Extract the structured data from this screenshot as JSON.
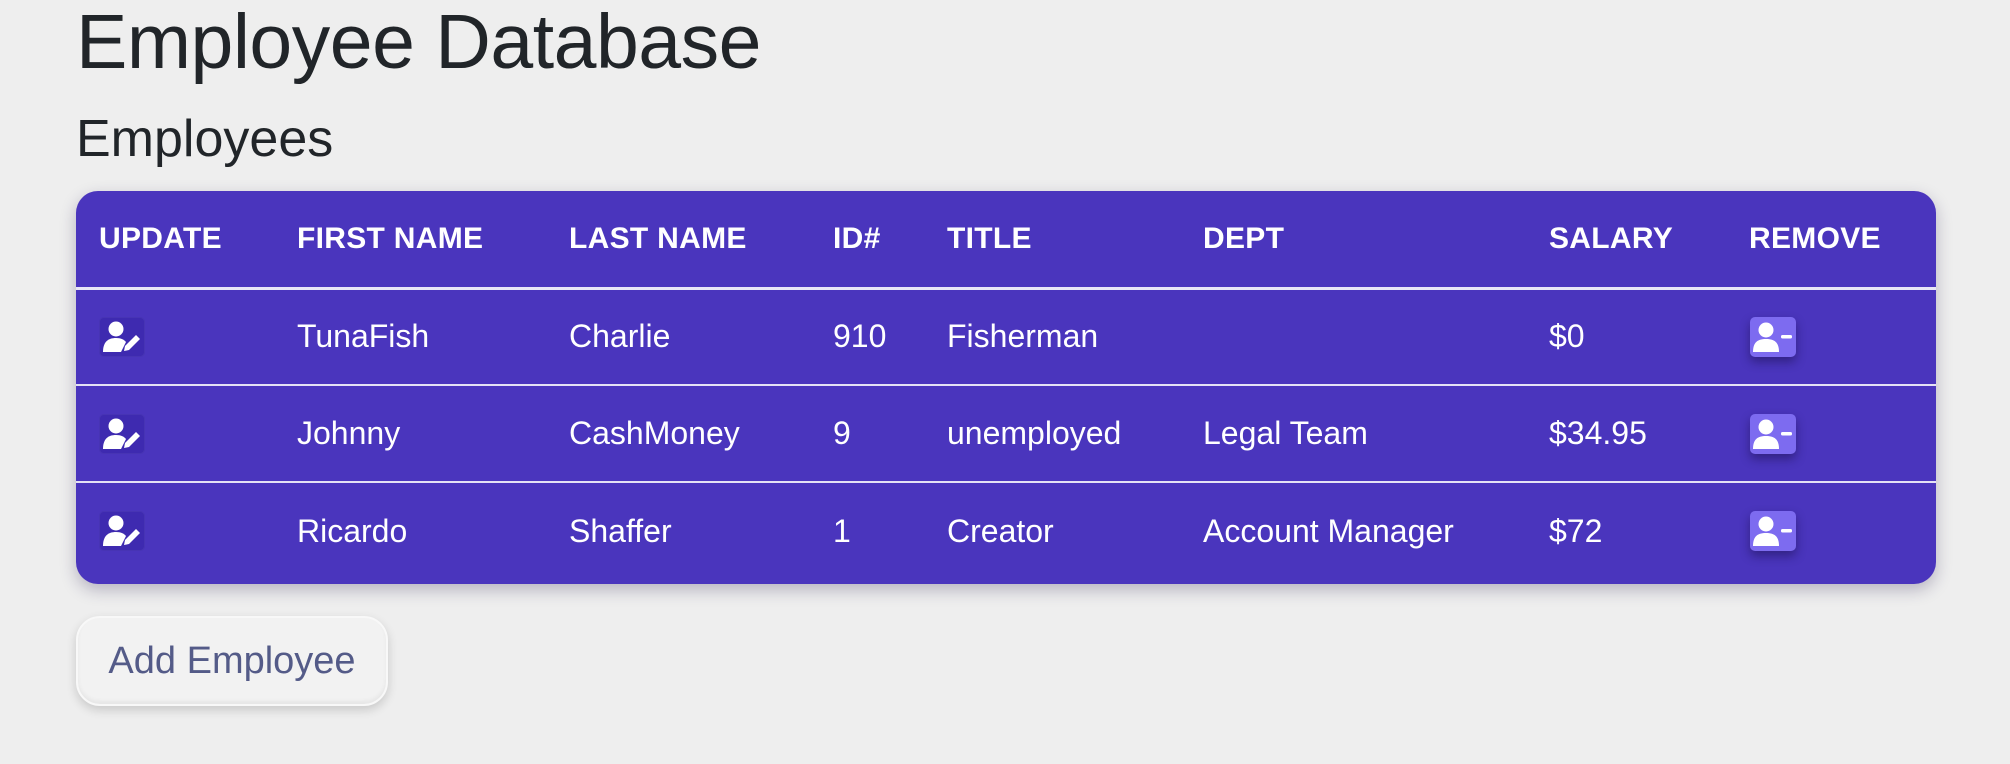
{
  "header": {
    "title": "Employee Database",
    "subtitle": "Employees"
  },
  "table": {
    "columns": [
      "UPDATE",
      "FIRST NAME",
      "LAST NAME",
      "ID#",
      "TITLE",
      "DEPT",
      "SALARY",
      "REMOVE"
    ],
    "rows": [
      {
        "first_name": "TunaFish",
        "last_name": "Charlie",
        "id": "910",
        "title": "Fisherman",
        "dept": "",
        "salary": "$0"
      },
      {
        "first_name": "Johnny",
        "last_name": "CashMoney",
        "id": "9",
        "title": "unemployed",
        "dept": "Legal Team",
        "salary": "$34.95"
      },
      {
        "first_name": "Ricardo",
        "last_name": "Shaffer",
        "id": "1",
        "title": "Creator",
        "dept": "Account Manager",
        "salary": "$72"
      }
    ],
    "update_icon": "user-edit-icon",
    "remove_icon": "user-remove-icon"
  },
  "actions": {
    "add_employee_label": "Add Employee"
  },
  "colors": {
    "background": "#eeeeee",
    "table_bg": "#4a35bd",
    "remove_button": "#7d6bf0",
    "edit_button": "#3e2ab0",
    "add_button_text": "#545b88"
  }
}
